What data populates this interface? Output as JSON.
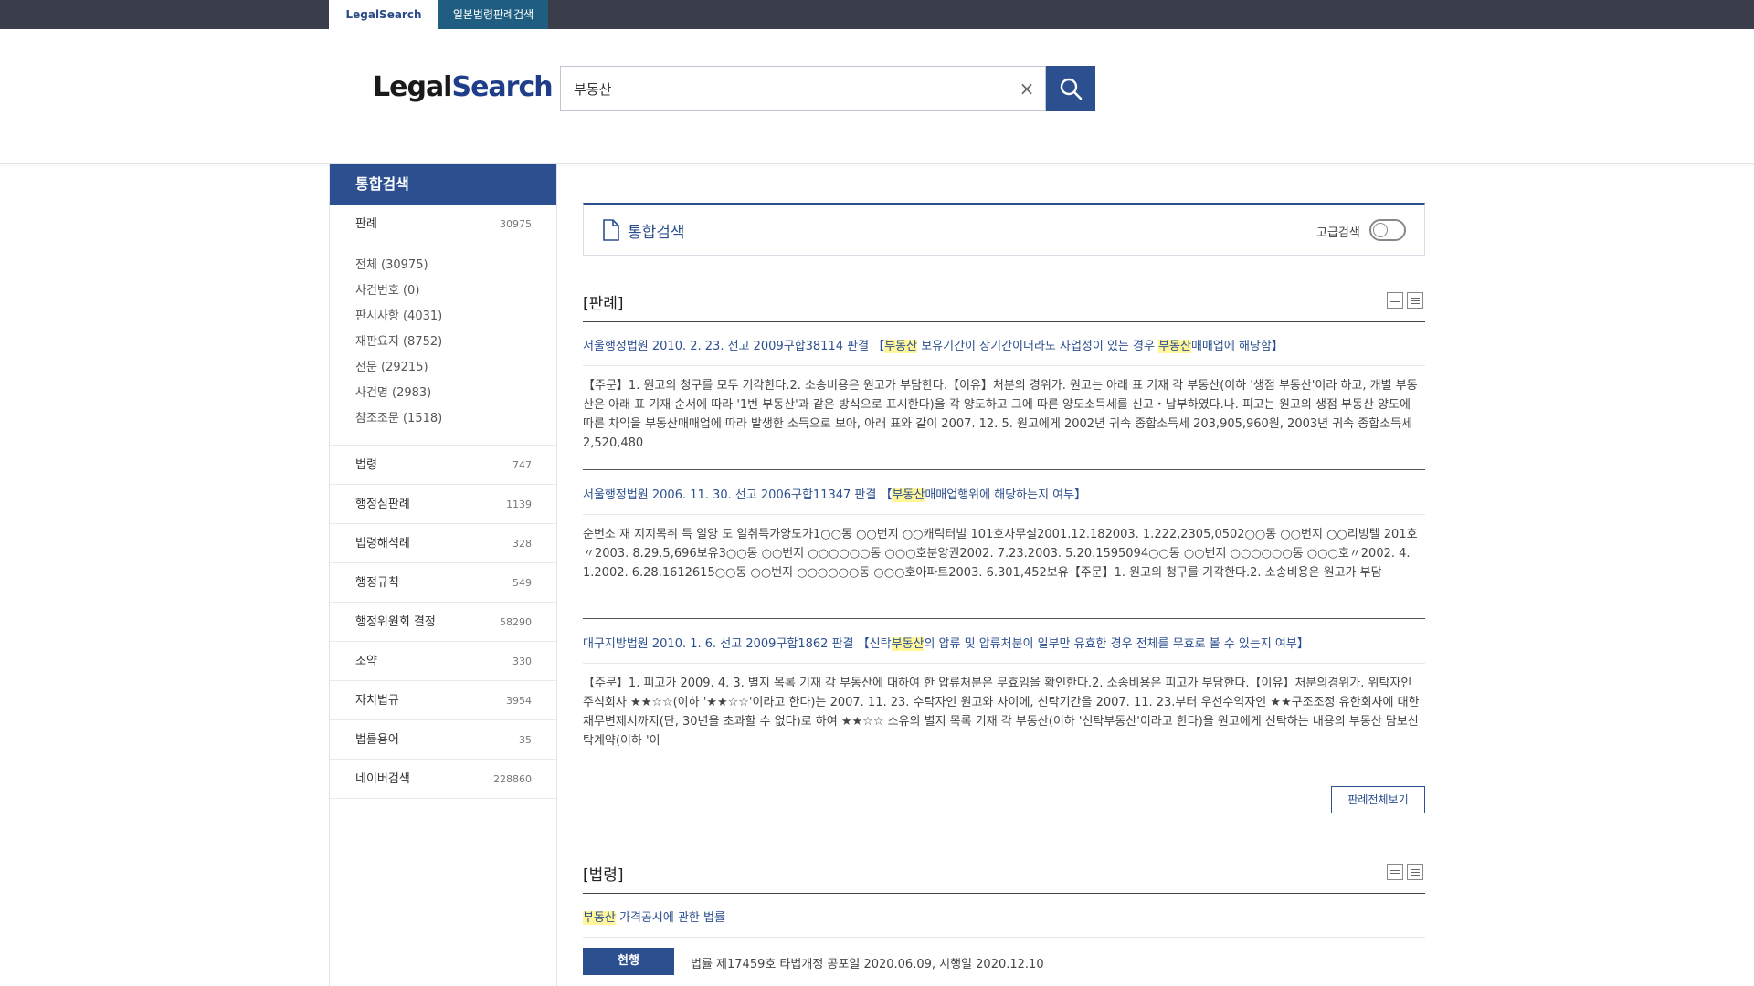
{
  "topbar": {
    "tabs": [
      {
        "label": "LegalSearch"
      },
      {
        "label": "일본법령판례검색"
      }
    ]
  },
  "header": {
    "logo_legal": "Legal",
    "logo_search": "Search",
    "search_value": "부동산",
    "clear_icon": "×"
  },
  "sidebar": {
    "title": "통합검색",
    "first": {
      "label": "판례",
      "count": "30975"
    },
    "subitems": [
      {
        "label": "전체 (30975)"
      },
      {
        "label": "사건번호 (0)"
      },
      {
        "label": "판시사항 (4031)"
      },
      {
        "label": "재판요지 (8752)"
      },
      {
        "label": "전문 (29215)"
      },
      {
        "label": "사건명 (2983)"
      },
      {
        "label": "참조조문 (1518)"
      }
    ],
    "categories": [
      {
        "label": "법령",
        "count": "747"
      },
      {
        "label": "행정심판례",
        "count": "1139"
      },
      {
        "label": "법령해석례",
        "count": "328"
      },
      {
        "label": "행정규칙",
        "count": "549"
      },
      {
        "label": "행정위원회 결정",
        "count": "58290"
      },
      {
        "label": "조약",
        "count": "330"
      },
      {
        "label": "자치법규",
        "count": "3954"
      },
      {
        "label": "법률용어",
        "count": "35"
      },
      {
        "label": "네이버검색",
        "count": "228860"
      }
    ]
  },
  "main": {
    "title": "통합검색",
    "advanced_label": "고급검색",
    "precedent_section": "[판례]",
    "results": [
      {
        "title_pre": "서울행정법원 2010. 2. 23. 선고 2009구합38114 판결 【",
        "title_hl1": "부동산",
        "title_mid": " 보유기간이 장기간이더라도 사업성이 있는 경우 ",
        "title_hl2": "부동산",
        "title_post": "매매업에 해당함】",
        "body": "【주문】1. 원고의 청구를 모두 기각한다.2. 소송비용은 원고가 부담한다.【이유】처분의 경위가. 원고는 아래 표 기재 각 부동산(이하 '생점 부동산'이라 하고, 개별 부동산은 아래 표 기재 순서에 따라 '1번 부동산'과 같은 방식으로 표시한다)을 각 양도하고 그에 따른 양도소득세를 신고・납부하였다.나. 피고는 원고의 생점 부동산 양도에 따른 차익을 부동산매매업에 따라 발생한 소득으로 보아, 아래 표와 같이 2007. 12. 5. 원고에게 2002년 귀속 종합소득세 203,905,960원, 2003년 귀속 종합소득세 2,520,480"
      },
      {
        "title_pre": "서울행정법원 2006. 11. 30. 선고 2006구합11347 판결 【",
        "title_hl1": "부동산",
        "title_mid": "매매업행위에 해당하는지 여부】",
        "title_hl2": "",
        "title_post": "",
        "body": "순번소 재 지지목취 득 일양 도 일취득가양도가1○○동 ○○번지 ○○캐릭터빌 101호사무실2001.12.182003. 1.222,2305,0502○○동 ○○번지 ○○리빙텔 201호〃2003. 8.29.5,696보유3○○동 ○○번지 ○○○○○○동 ○○○호분양권2002. 7.23.2003. 5.20.1595094○○동 ○○번지 ○○○○○○동 ○○○호〃2002. 4. 1.2002. 6.28.1612615○○동 ○○번지 ○○○○○○동 ○○○호아파트2003. 6.301,452보유【주문】1. 원고의 청구를 기각한다.2. 소송비용은 원고가 부담"
      },
      {
        "title_pre": "대구지방법원 2010. 1. 6. 선고 2009구합1862 판결 【신탁",
        "title_hl1": "부동산",
        "title_mid": "의 압류 및 압류처분이 일부만 유효한 경우 전체를 무효로 볼 수 있는지 여부】",
        "title_hl2": "",
        "title_post": "",
        "body": "【주문】1. 피고가 2009. 4. 3. 별지 목록 기재 각 부동산에 대하여 한 압류처분은 무효임을 확인한다.2. 소송비용은 피고가 부담한다.【이유】처분의경위가. 위탁자인 주식회사 ★★☆☆(이하 '★★☆☆'이라고 한다)는 2007. 11. 23. 수탁자인 원고와 사이에, 신탁기간을 2007. 11. 23.부터 우선수익자인 ★★구조조정 유한회사에 대한 채무변제시까지(단, 30년을 초과할 수 없다)로 하여 ★★☆☆ 소유의 별지 목록 기재 각 부동산(이하 '신탁부동산'이라고 한다)을 원고에게 신탁하는 내용의 부동산 담보신탁계약(이하 '이"
      }
    ],
    "view_all_precedents": "판례전체보기",
    "law_section": "[법령]",
    "law": {
      "title_hl": "부동산",
      "title_rest": " 가격공시에 관한 법률",
      "status": "현행",
      "info": "법률 제17459호 타법개정 공포일 2020.06.09, 시행일 2020.12.10"
    }
  },
  "colors": {
    "brand": "#2c4f8f",
    "topbar": "#3a3e4a",
    "highlight": "#fff59a"
  }
}
